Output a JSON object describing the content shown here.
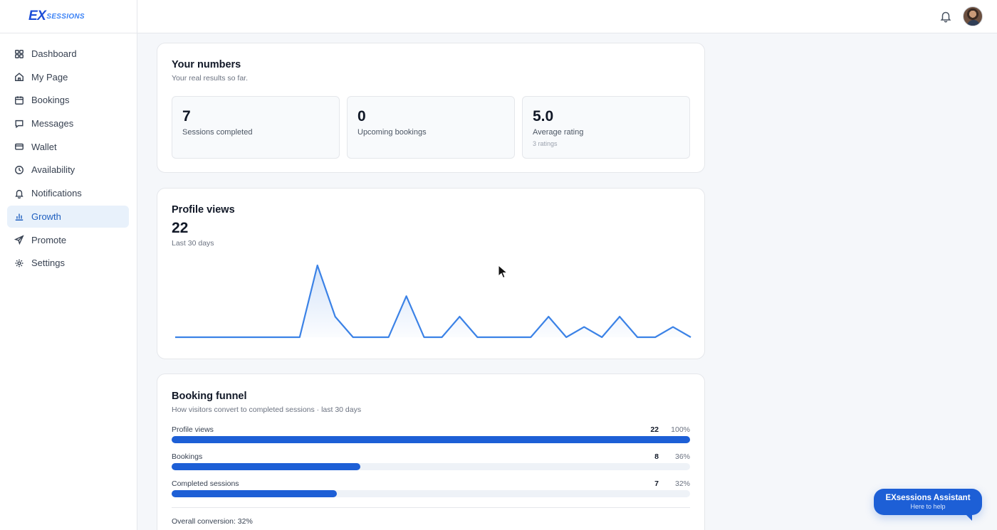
{
  "brand": {
    "logo_main": "EX",
    "logo_sub": "SESSIONS",
    "accent": "#1d5fd6"
  },
  "sidebar": {
    "items": [
      {
        "label": "Dashboard",
        "icon": "grid-icon",
        "active": false
      },
      {
        "label": "My Page",
        "icon": "home-icon",
        "active": false
      },
      {
        "label": "Bookings",
        "icon": "calendar-icon",
        "active": false
      },
      {
        "label": "Messages",
        "icon": "message-icon",
        "active": false
      },
      {
        "label": "Wallet",
        "icon": "wallet-icon",
        "active": false
      },
      {
        "label": "Availability",
        "icon": "clock-icon",
        "active": false
      },
      {
        "label": "Notifications",
        "icon": "bell-icon",
        "active": false
      },
      {
        "label": "Growth",
        "icon": "bar-chart-icon",
        "active": true
      },
      {
        "label": "Promote",
        "icon": "send-icon",
        "active": false
      },
      {
        "label": "Settings",
        "icon": "gear-icon",
        "active": false
      }
    ]
  },
  "numbers": {
    "title": "Your numbers",
    "subtitle": "Your real results so far.",
    "stats": [
      {
        "value": "7",
        "label": "Sessions completed",
        "sub": ""
      },
      {
        "value": "0",
        "label": "Upcoming bookings",
        "sub": ""
      },
      {
        "value": "5.0",
        "label": "Average rating",
        "sub": "3 ratings"
      }
    ]
  },
  "profile_views": {
    "title": "Profile views",
    "total": "22",
    "period": "Last 30 days"
  },
  "chart_data": {
    "type": "area",
    "title": "Profile views",
    "xlabel": "",
    "ylabel": "",
    "x": [
      1,
      2,
      3,
      4,
      5,
      6,
      7,
      8,
      9,
      10,
      11,
      12,
      13,
      14,
      15,
      16,
      17,
      18,
      19,
      20,
      21,
      22,
      23,
      24,
      25,
      26,
      27,
      28,
      29,
      30
    ],
    "values": [
      0,
      0,
      0,
      0,
      0,
      0,
      0,
      0,
      7,
      2,
      0,
      0,
      0,
      4,
      0,
      0,
      2,
      0,
      0,
      0,
      0,
      2,
      0,
      1,
      0,
      2,
      0,
      0,
      1,
      0
    ],
    "ylim": [
      0,
      7
    ],
    "grid": false,
    "color": "#3b82e6"
  },
  "funnel": {
    "title": "Booking funnel",
    "subtitle": "How visitors convert to completed sessions · last 30 days",
    "rows": [
      {
        "label": "Profile views",
        "count": "22",
        "percent": "100%",
        "fraction": 1.0
      },
      {
        "label": "Bookings",
        "count": "8",
        "percent": "36%",
        "fraction": 0.364
      },
      {
        "label": "Completed sessions",
        "count": "7",
        "percent": "32%",
        "fraction": 0.318
      }
    ],
    "overall": "Overall conversion: 32%"
  },
  "assistant": {
    "title": "EXsessions Assistant",
    "subtitle": "Here to help"
  },
  "topbar": {
    "bell_icon": "bell-icon",
    "avatar": "user-avatar"
  }
}
